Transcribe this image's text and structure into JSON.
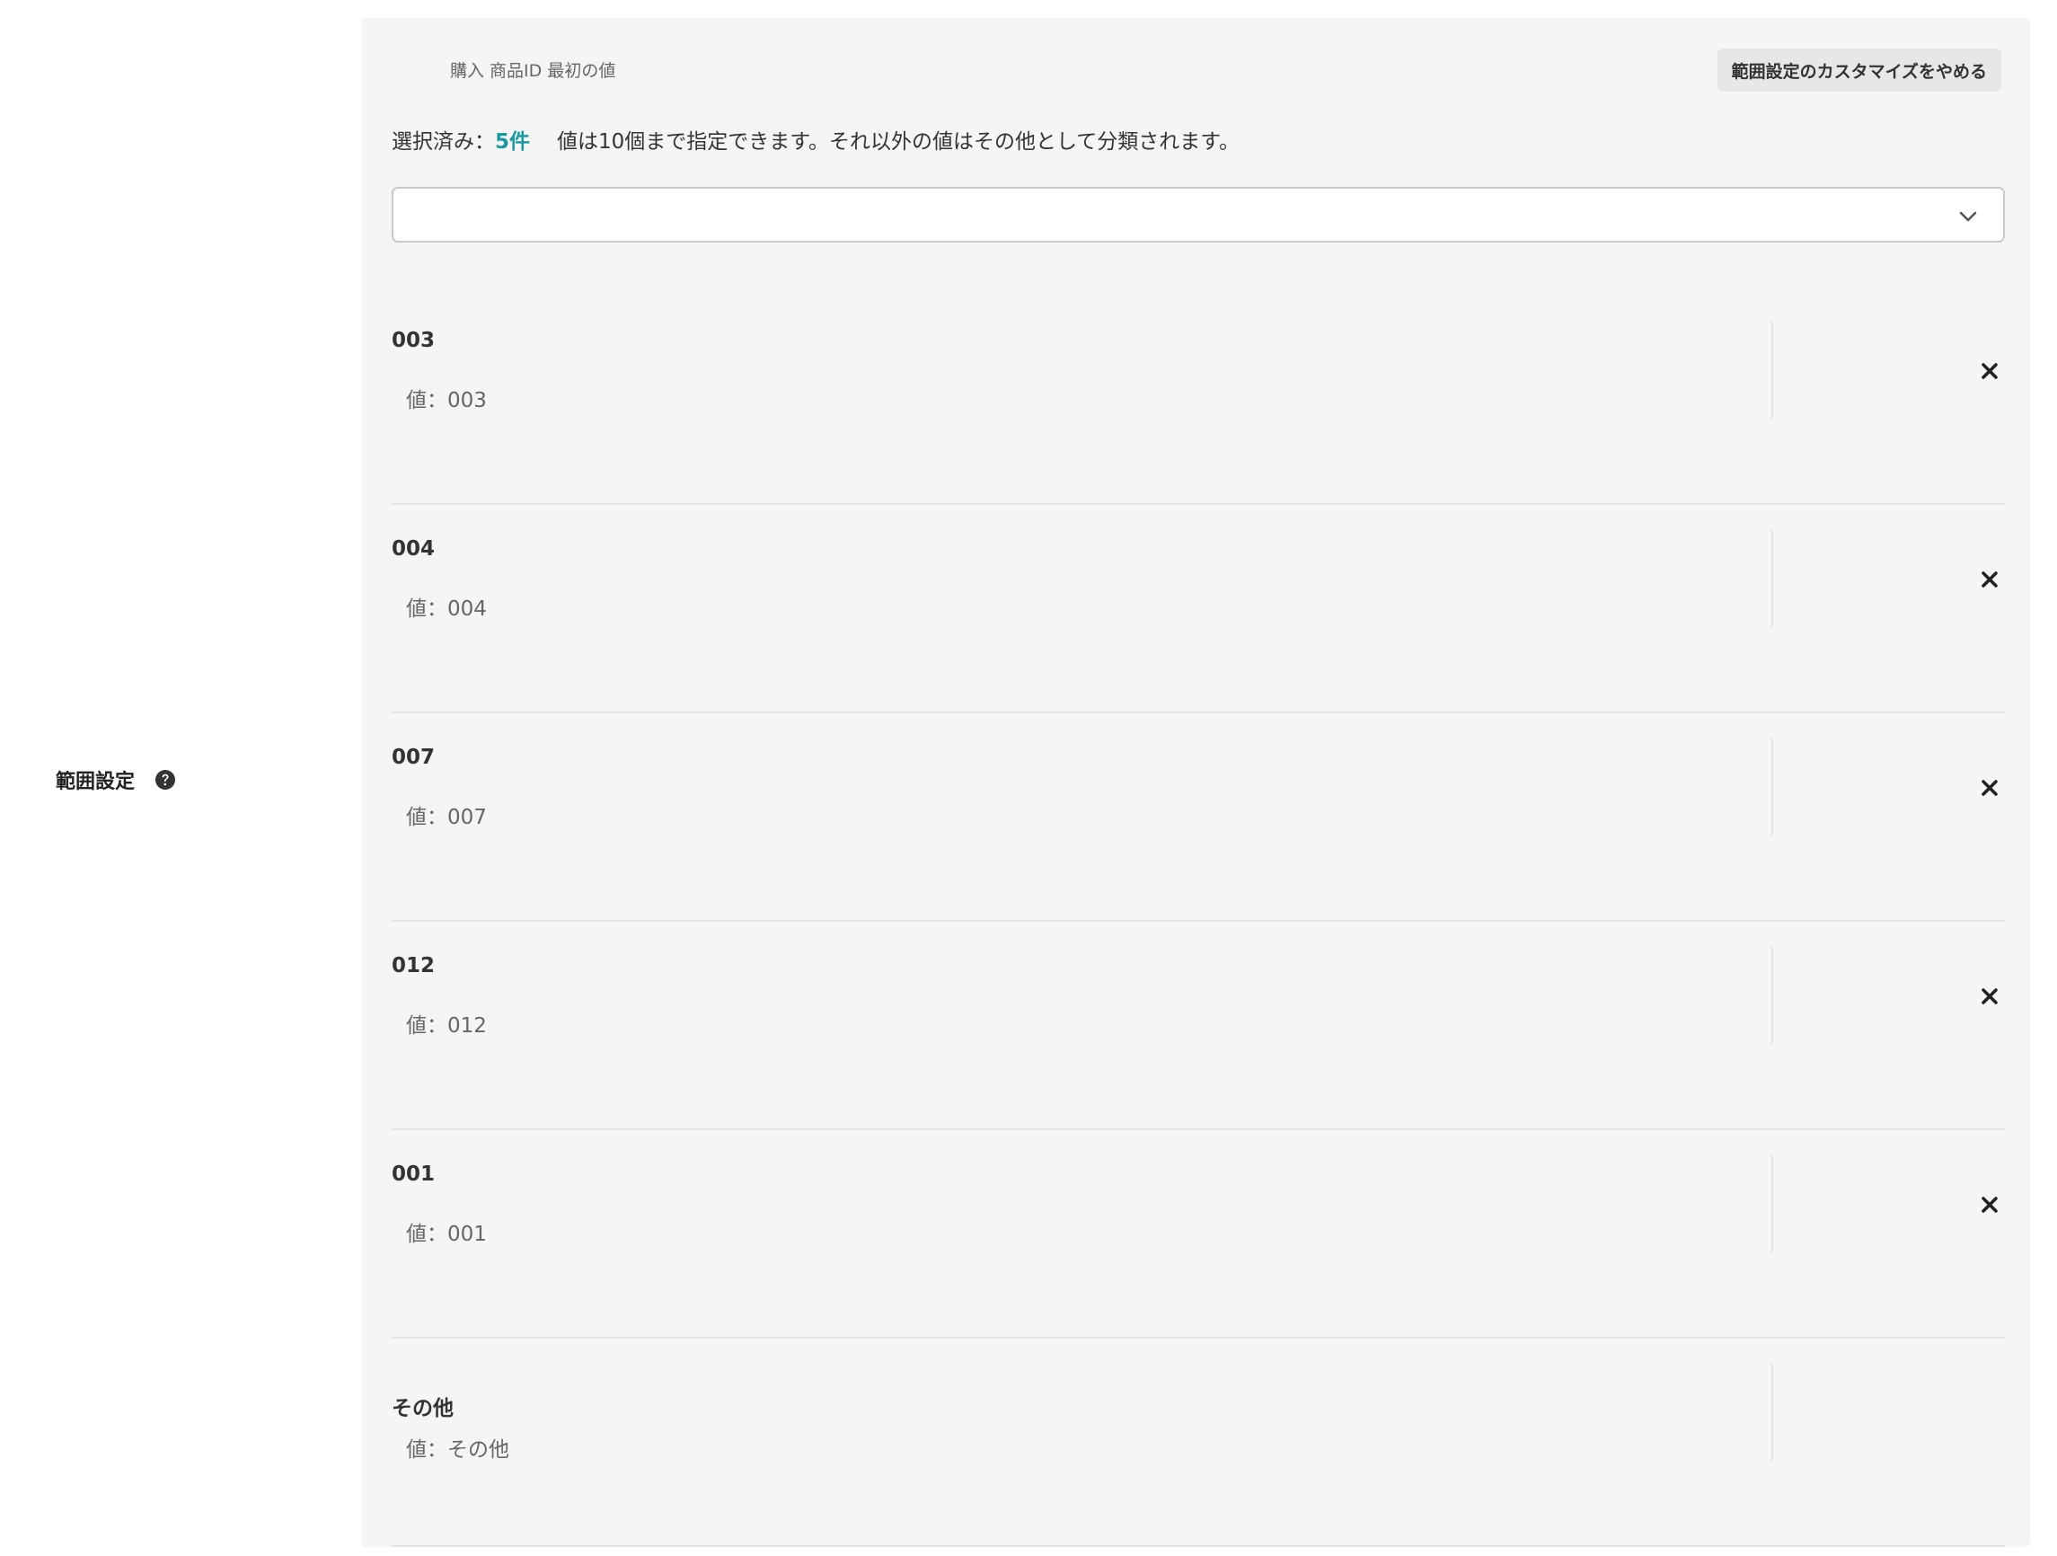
{
  "left": {
    "section_label": "範囲設定",
    "help_icon": "question-circle-icon"
  },
  "panel": {
    "field_name": "購入 商品ID 最初の値",
    "stop_customize_button": "範囲設定のカスタマイズをやめる",
    "selected_prefix": "選択済み：",
    "selected_count": "5件",
    "note": "値は10個まで指定できます。それ以外の値はその他として分類されます。",
    "dropdown": {
      "value": "",
      "icon": "chevron-down-icon"
    },
    "items": [
      {
        "name": "003",
        "value": "値：003"
      },
      {
        "name": "004",
        "value": "値：004"
      },
      {
        "name": "007",
        "value": "値：007"
      },
      {
        "name": "012",
        "value": "値：012"
      },
      {
        "name": "001",
        "value": "値：001"
      },
      {
        "name": "その他",
        "value": "値：その他"
      }
    ]
  },
  "colors": {
    "accent": "#1a9aa0",
    "panel_bg": "#f5f5f5",
    "button_bg": "#e7e7e7"
  }
}
